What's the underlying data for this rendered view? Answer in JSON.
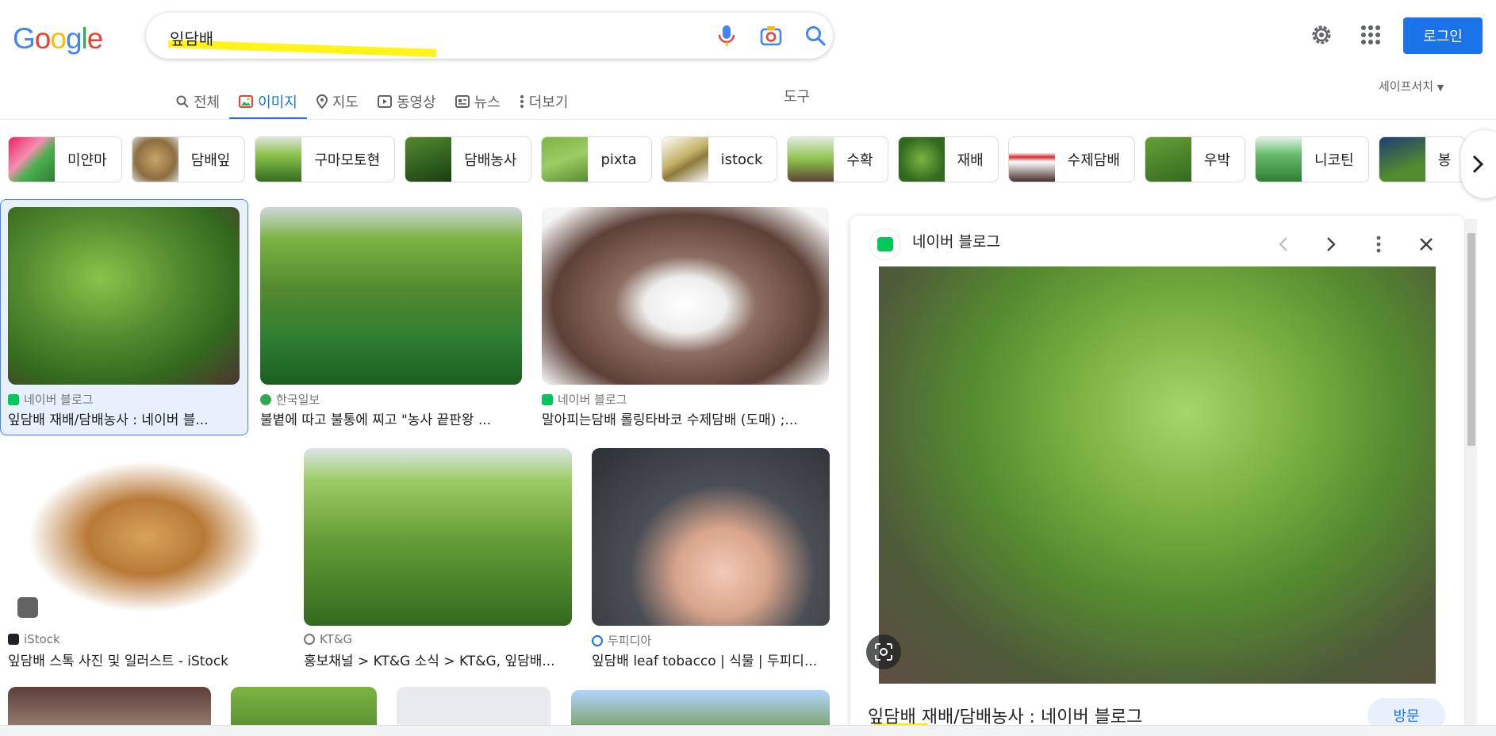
{
  "header": {
    "logo_letters": [
      "G",
      "o",
      "o",
      "g",
      "l",
      "e"
    ],
    "query": "잎담배",
    "login_label": "로그인",
    "icons": [
      "microphone-icon",
      "camera-search-icon",
      "search-icon",
      "settings-gear-icon",
      "apps-grid-icon"
    ]
  },
  "tabs": [
    {
      "label": "전체",
      "icon": "search-icon"
    },
    {
      "label": "이미지",
      "icon": "image-icon"
    },
    {
      "label": "지도",
      "icon": "map-pin-icon"
    },
    {
      "label": "동영상",
      "icon": "play-icon"
    },
    {
      "label": "뉴스",
      "icon": "news-icon"
    },
    {
      "label": "더보기",
      "icon": "more-vert-icon"
    }
  ],
  "tools_label": "도구",
  "safesearch_label": "세이프서치",
  "chips": [
    "미얀마",
    "담배잎",
    "구마모토현",
    "담배농사",
    "pixta",
    "istock",
    "수확",
    "재배",
    "수제담배",
    "우박",
    "니코틴",
    "봉"
  ],
  "results": [
    {
      "source": "네이버 블로그",
      "title": "잎담배 재배/담배농사 : 네이버 블..."
    },
    {
      "source": "한국일보",
      "title": "불볕에 따고 불통에 찌고 \"농사 끝판왕 ..."
    },
    {
      "source": "네이버 블로그",
      "title": "말아피는담배 롤링타바코 수제담배 (도매) ;..."
    },
    {
      "source": "iStock",
      "title": "잎담배 스톡 사진 및 일러스트 - iStock"
    },
    {
      "source": "KT&G",
      "title": "홍보채널 > KT&G 소식 > KT&G, 잎담배..."
    },
    {
      "source": "두피디아",
      "title": "잎담배 leaf tobacco | 식물 | 두피디..."
    }
  ],
  "panel": {
    "source": "네이버 블로그",
    "title": "잎담배 재배/담배농사 : 네이버 블로그",
    "visit_label": "방문"
  },
  "colors": {
    "accent": "#1a73e8",
    "naver": "#03c75a",
    "highlight": "#fff200"
  }
}
